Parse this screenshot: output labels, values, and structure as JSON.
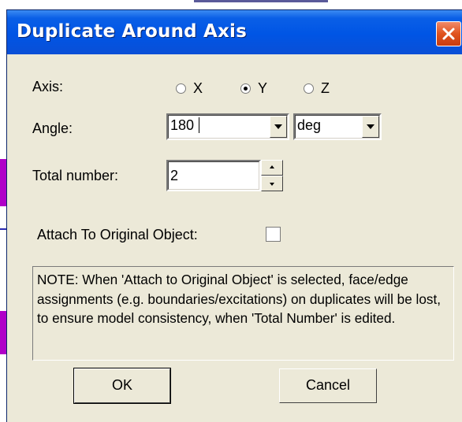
{
  "dialog": {
    "title": "Duplicate Around Axis",
    "close_icon": "close-icon"
  },
  "axis": {
    "label": "Axis:",
    "options": [
      "X",
      "Y",
      "Z"
    ],
    "selected": "Y"
  },
  "angle": {
    "label": "Angle:",
    "value": "180",
    "unit": "deg"
  },
  "total_number": {
    "label": "Total number:",
    "value": "2"
  },
  "attach": {
    "label": "Attach To Original Object:",
    "checked": false
  },
  "note": "NOTE:  When 'Attach to Original Object' is selected, face/edge assignments (e.g. boundaries/excitations) on duplicates will be lost, to ensure model consistency, when 'Total Number' is edited.",
  "buttons": {
    "ok": "OK",
    "cancel": "Cancel"
  },
  "colors": {
    "titlebar": "#0055e5",
    "dialog_bg": "#ece9d8",
    "close_button": "#e0531f"
  }
}
